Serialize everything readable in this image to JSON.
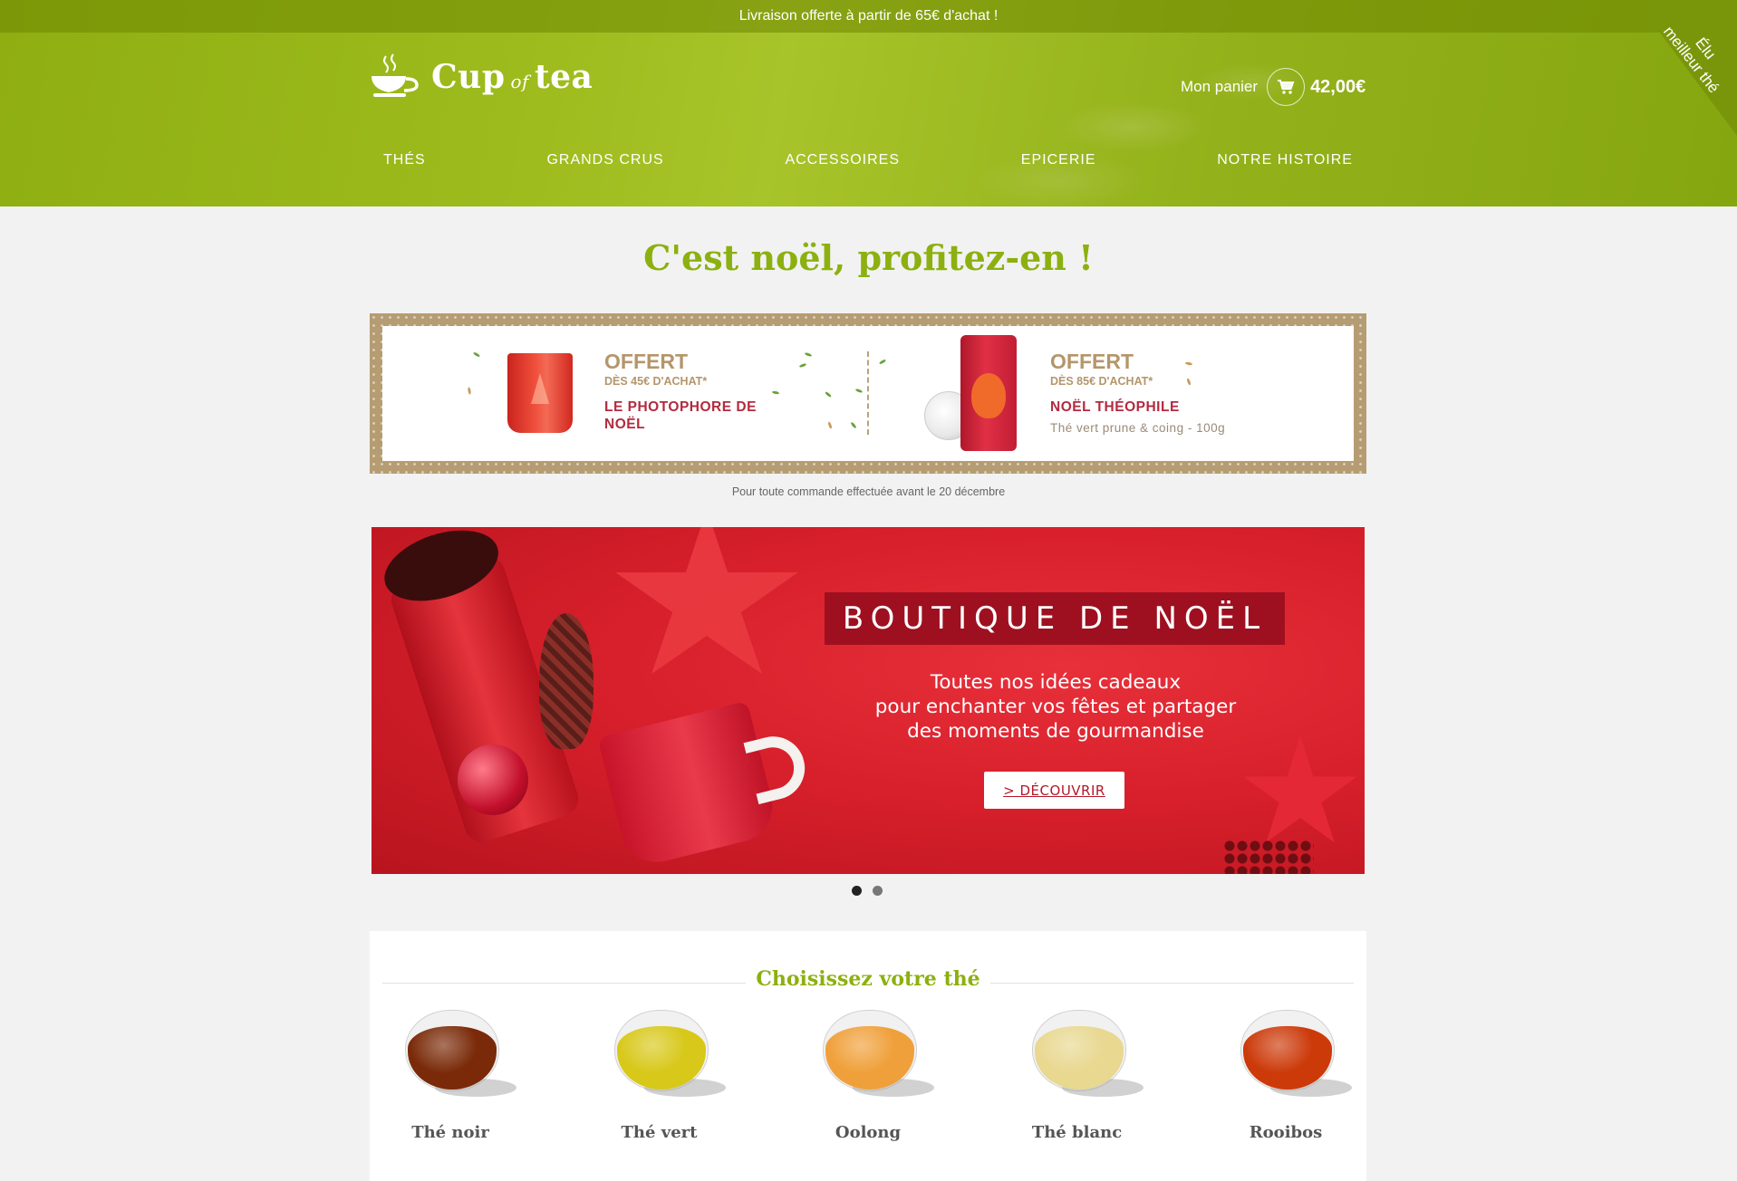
{
  "topbar": {
    "text": "Livraison offerte à partir de 65€ d'achat !"
  },
  "logo": {
    "cup": "Cup",
    "of": "of",
    "tea": "tea"
  },
  "cart": {
    "label": "Mon panier",
    "total": "42,00€"
  },
  "nav": [
    {
      "label": "THÉS"
    },
    {
      "label": "GRANDS CRUS"
    },
    {
      "label": "ACCESSOIRES"
    },
    {
      "label": "EPICERIE"
    },
    {
      "label": "NOTRE HISTOIRE"
    }
  ],
  "ribbon": {
    "line1": "Élu",
    "line2": "meilleur thé"
  },
  "page_title": "C'est noël, profitez-en !",
  "offers": [
    {
      "title": "OFFERT",
      "condition": "DÈS 45€ D'ACHAT*",
      "product": "LE PHOTOPHORE DE NOËL",
      "detail": ""
    },
    {
      "title": "OFFERT",
      "condition": "DÈS 85€ D'ACHAT*",
      "product": "NOËL THÉOPHILE",
      "detail": "Thé vert prune & coing - 100g"
    }
  ],
  "offer_note": "Pour toute commande effectuée avant le 20 décembre",
  "hero": {
    "title": "BOUTIQUE DE NOËL",
    "subtitle_lines": [
      "Toutes nos idées cadeaux",
      "pour enchanter vos fêtes et partager",
      "des moments de gourmandise"
    ],
    "button": "> DÉCOUVRIR"
  },
  "carousel": {
    "slides": 2,
    "active": 0
  },
  "tea_section": {
    "heading": "Choisissez votre thé",
    "items": [
      {
        "name": "Thé noir",
        "color": "#7a2a08"
      },
      {
        "name": "Thé vert",
        "color": "#d8c81a"
      },
      {
        "name": "Oolong",
        "color": "#f0a03a"
      },
      {
        "name": "Thé blanc",
        "color": "#e8d890"
      },
      {
        "name": "Rooibos",
        "color": "#cc3a0a"
      }
    ]
  },
  "colors": {
    "brand_green": "#8cb010",
    "header_green": "#9dbb1c",
    "hero_red": "#d8202c"
  },
  "icons": {
    "logo": "teacup-icon",
    "cart": "cart-icon"
  }
}
